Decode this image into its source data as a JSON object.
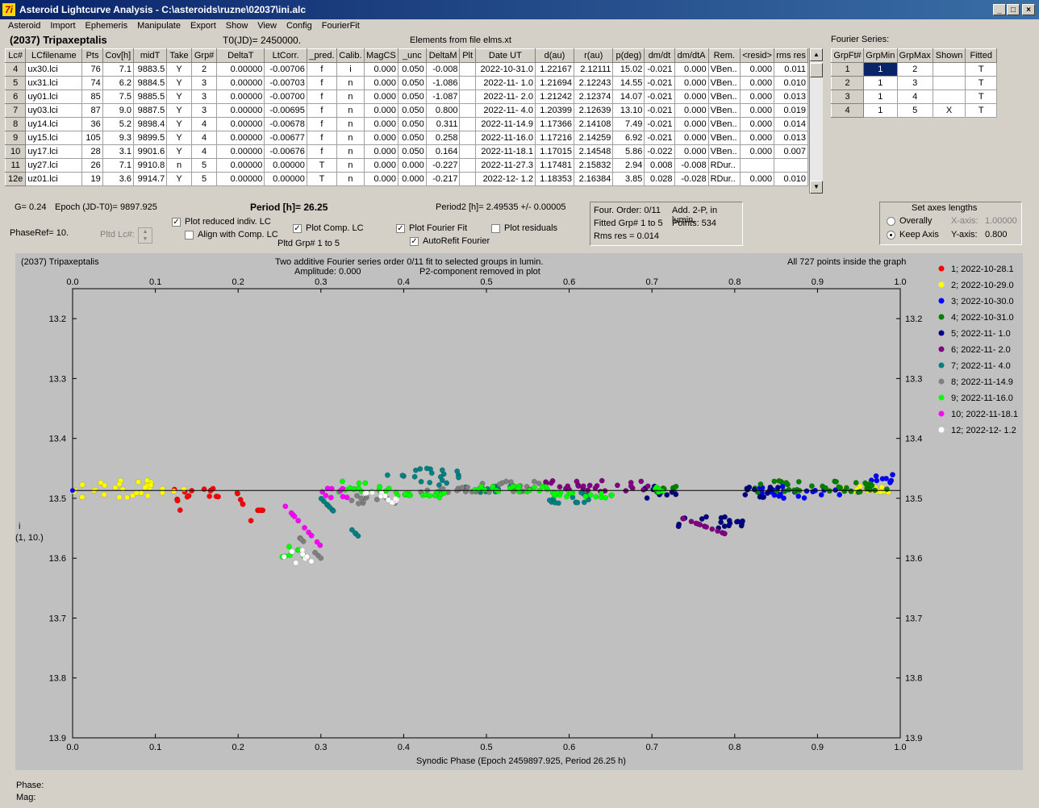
{
  "window": {
    "title": "Asteroid Lightcurve Analysis - C:\\asteroids\\ruzne\\02037\\ini.alc",
    "icon_label": "7i"
  },
  "menu": [
    "Asteroid",
    "Import",
    "Ephemeris",
    "Manipulate",
    "Export",
    "Show",
    "View",
    "Config",
    "FourierFit"
  ],
  "header": {
    "asteroid": "(2037) Tripaxeptalis",
    "t0": "T0(JD)= 2450000.",
    "elements": "Elements from file elms.xt",
    "fourier_label": "Fourier Series:"
  },
  "lc_table": {
    "columns": [
      "Lc#",
      "LCfilename",
      "Pts",
      "Cov[h]",
      "midT",
      "Take",
      "Grp#",
      "DeltaT",
      "LtCorr.",
      "_pred.",
      "Calib.",
      "MagCS",
      "_unc",
      "DeltaM",
      "Plt",
      "Date UT",
      "d(au)",
      "r(au)",
      "p(deg)",
      "dm/dt",
      "dm/dtA",
      "Rem.",
      "<resid>",
      "rms res"
    ],
    "rows": [
      [
        "4",
        "ux30.lci",
        "76",
        "7.1",
        "9883.5",
        "Y",
        "2",
        "0.00000",
        "-0.00706",
        "f",
        "i",
        "0.000",
        "0.050",
        "-0.008",
        "",
        "2022-10-31.0",
        "1.22167",
        "2.12111",
        "15.02",
        "-0.021",
        "0.000",
        "VBen..",
        "0.000",
        "0.011"
      ],
      [
        "5",
        "ux31.lci",
        "74",
        "6.2",
        "9884.5",
        "Y",
        "3",
        "0.00000",
        "-0.00703",
        "f",
        "n",
        "0.000",
        "0.050",
        "-1.086",
        "",
        "2022-11- 1.0",
        "1.21694",
        "2.12243",
        "14.55",
        "-0.021",
        "0.000",
        "VBen..",
        "0.000",
        "0.010"
      ],
      [
        "6",
        "uy01.lci",
        "85",
        "7.5",
        "9885.5",
        "Y",
        "3",
        "0.00000",
        "-0.00700",
        "f",
        "n",
        "0.000",
        "0.050",
        "-1.087",
        "",
        "2022-11- 2.0",
        "1.21242",
        "2.12374",
        "14.07",
        "-0.021",
        "0.000",
        "VBen..",
        "0.000",
        "0.013"
      ],
      [
        "7",
        "uy03.lci",
        "87",
        "9.0",
        "9887.5",
        "Y",
        "3",
        "0.00000",
        "-0.00695",
        "f",
        "n",
        "0.000",
        "0.050",
        "0.800",
        "",
        "2022-11- 4.0",
        "1.20399",
        "2.12639",
        "13.10",
        "-0.021",
        "0.000",
        "VBen..",
        "0.000",
        "0.019"
      ],
      [
        "8",
        "uy14.lci",
        "36",
        "5.2",
        "9898.4",
        "Y",
        "4",
        "0.00000",
        "-0.00678",
        "f",
        "n",
        "0.000",
        "0.050",
        "0.311",
        "",
        "2022-11-14.9",
        "1.17366",
        "2.14108",
        "7.49",
        "-0.021",
        "0.000",
        "VBen..",
        "0.000",
        "0.014"
      ],
      [
        "9",
        "uy15.lci",
        "105",
        "9.3",
        "9899.5",
        "Y",
        "4",
        "0.00000",
        "-0.00677",
        "f",
        "n",
        "0.000",
        "0.050",
        "0.258",
        "",
        "2022-11-16.0",
        "1.17216",
        "2.14259",
        "6.92",
        "-0.021",
        "0.000",
        "VBen..",
        "0.000",
        "0.013"
      ],
      [
        "10",
        "uy17.lci",
        "28",
        "3.1",
        "9901.6",
        "Y",
        "4",
        "0.00000",
        "-0.00676",
        "f",
        "n",
        "0.000",
        "0.050",
        "0.164",
        "",
        "2022-11-18.1",
        "1.17015",
        "2.14548",
        "5.86",
        "-0.022",
        "0.000",
        "VBen..",
        "0.000",
        "0.007"
      ],
      [
        "11",
        "uy27.lci",
        "26",
        "7.1",
        "9910.8",
        "n",
        "5",
        "0.00000",
        "0.00000",
        "T",
        "n",
        "0.000",
        "0.000",
        "-0.227",
        "",
        "2022-11-27.3",
        "1.17481",
        "2.15832",
        "2.94",
        "0.008",
        "-0.008",
        "RDur..",
        "",
        ""
      ],
      [
        "12e",
        "uz01.lci",
        "19",
        "3.6",
        "9914.7",
        "Y",
        "5",
        "0.00000",
        "0.00000",
        "T",
        "n",
        "0.000",
        "0.000",
        "-0.217",
        "",
        "2022-12- 1.2",
        "1.18353",
        "2.16384",
        "3.85",
        "0.028",
        "-0.028",
        "RDur..",
        "0.000",
        "0.010"
      ]
    ]
  },
  "fourier_table": {
    "columns": [
      "GrpFt#",
      "GrpMin",
      "GrpMax",
      "Shown",
      "Fitted"
    ],
    "rows": [
      [
        "1",
        "1",
        "2",
        "",
        "T"
      ],
      [
        "2",
        "1",
        "3",
        "",
        "T"
      ],
      [
        "3",
        "1",
        "4",
        "",
        "T"
      ],
      [
        "4",
        "1",
        "5",
        "X",
        "T"
      ]
    ]
  },
  "params": {
    "g": "G= 0.24",
    "epoch": "Epoch (JD-T0)= 9897.925",
    "period": "Period [h]= 26.25",
    "period2": "Period2 [h]= 2.49535 +/- 0.00005",
    "phase_ref": "PhaseRef= 10.",
    "pltd_lc": "Pltd Lc#:",
    "pltd_grp": "Pltd Grp#  1   to   5"
  },
  "checkboxes": {
    "plot_reduced": {
      "label": "Plot reduced indiv. LC",
      "checked": true
    },
    "align_comp": {
      "label": "Align with Comp. LC",
      "checked": false
    },
    "plot_comp": {
      "label": "Plot Comp. LC",
      "checked": true
    },
    "plot_fourier": {
      "label": "Plot Fourier Fit",
      "checked": true
    },
    "autorefit": {
      "label": "AutoRefit Fourier",
      "checked": true
    },
    "plot_resid": {
      "label": "Plot residuals",
      "checked": false
    }
  },
  "fourier_info": {
    "order": "Four. Order:  0/11",
    "add": "Add. 2-P, in lumin.",
    "fitted": "Fitted Grp# 1 to 5",
    "points": "Points: 534",
    "rms": "Rms res      = 0.014"
  },
  "axes_box": {
    "title": "Set axes lengths",
    "overally": "Overally",
    "keep": "Keep Axis",
    "xaxis_label": "X-axis:",
    "xaxis_val": "1.00000",
    "yaxis_label": "Y-axis:",
    "yaxis_val": "0.800"
  },
  "plot": {
    "name": "(2037) Tripaxeptalis",
    "desc1": "Two additive Fourier series order 0/11 fit to selected groups in lumin.",
    "desc2": "Amplitude: 0.000",
    "desc3": "P2-component removed in plot",
    "points_note": "All 727 points inside the graph",
    "ylabel1": "i",
    "ylabel2": "(1, 10.)",
    "xlabel": "Synodic Phase (Epoch 2459897.925, Period 26.25 h)"
  },
  "status": {
    "phase": "Phase:",
    "mag": "Mag:"
  },
  "chart_data": {
    "type": "scatter",
    "xlim": [
      0.0,
      1.0
    ],
    "ylim": [
      13.9,
      13.15
    ],
    "xticks": [
      "0.0",
      "0.1",
      "0.2",
      "0.3",
      "0.4",
      "0.5",
      "0.6",
      "0.7",
      "0.8",
      "0.9",
      "1.0"
    ],
    "yticks": [
      "13.2",
      "13.3",
      "13.4",
      "13.5",
      "13.6",
      "13.7",
      "13.8",
      "13.9"
    ],
    "fit_level": 13.487,
    "legend_position": "right",
    "series": [
      {
        "name": "1; 2022-10-28.1",
        "color": "#ff0000",
        "segments": [
          [
            0.12,
            0.13,
            13.47,
            13.52
          ],
          [
            0.13,
            0.18,
            13.48,
            13.5
          ],
          [
            0.195,
            0.22,
            13.48,
            13.55
          ],
          [
            0.22,
            0.23,
            13.52,
            13.52
          ]
        ]
      },
      {
        "name": "2; 2022-10-29.0",
        "color": "#ffff00",
        "segments": [
          [
            0.0,
            0.135,
            13.47,
            13.5
          ],
          [
            0.93,
            1.0,
            13.48,
            13.49
          ]
        ]
      },
      {
        "name": "3; 2022-10-30.0",
        "color": "#0000ff",
        "segments": [
          [
            0.82,
            0.93,
            13.48,
            13.5
          ],
          [
            0.96,
            1.0,
            13.46,
            13.48
          ]
        ]
      },
      {
        "name": "4; 2022-10-31.0",
        "color": "#008000",
        "segments": [
          [
            0.69,
            0.73,
            13.48,
            13.49
          ],
          [
            0.82,
            1.0,
            13.47,
            13.49
          ]
        ]
      },
      {
        "name": "5; 2022-11- 1.0",
        "color": "#000080",
        "segments": [
          [
            0.69,
            0.73,
            13.48,
            13.5
          ],
          [
            0.73,
            0.81,
            13.53,
            13.55
          ],
          [
            0.81,
            0.86,
            13.48,
            13.5
          ]
        ]
      },
      {
        "name": "6; 2022-11- 2.0",
        "color": "#800080",
        "segments": [
          [
            0.57,
            0.7,
            13.47,
            13.49
          ],
          [
            0.73,
            0.79,
            13.53,
            13.56
          ]
        ]
      },
      {
        "name": "7; 2022-11- 4.0",
        "color": "#008080",
        "segments": [
          [
            0.3,
            0.35,
            13.5,
            13.57
          ],
          [
            0.38,
            0.47,
            13.45,
            13.48
          ],
          [
            0.47,
            0.54,
            13.48,
            13.49
          ],
          [
            0.57,
            0.63,
            13.49,
            13.51
          ]
        ]
      },
      {
        "name": "8; 2022-11-14.9",
        "color": "#808080",
        "segments": [
          [
            0.27,
            0.3,
            13.56,
            13.6
          ],
          [
            0.33,
            0.39,
            13.49,
            13.51
          ],
          [
            0.42,
            0.49,
            13.48,
            13.49
          ],
          [
            0.49,
            0.57,
            13.47,
            13.49
          ]
        ]
      },
      {
        "name": "9; 2022-11-16.0",
        "color": "#00ff00",
        "segments": [
          [
            0.25,
            0.28,
            13.57,
            13.6
          ],
          [
            0.32,
            0.39,
            13.47,
            13.49
          ],
          [
            0.39,
            0.46,
            13.49,
            13.5
          ],
          [
            0.48,
            0.58,
            13.48,
            13.49
          ],
          [
            0.58,
            0.66,
            13.49,
            13.5
          ],
          [
            0.7,
            0.72,
            13.48,
            13.49
          ]
        ]
      },
      {
        "name": "10; 2022-11-18.1",
        "color": "#ff00ff",
        "segments": [
          [
            0.255,
            0.3,
            13.51,
            13.58
          ],
          [
            0.3,
            0.34,
            13.48,
            13.5
          ]
        ]
      },
      {
        "name": "12; 2022-12- 1.2",
        "color": "#ffffff",
        "segments": [
          [
            0.255,
            0.29,
            13.58,
            13.61
          ],
          [
            0.35,
            0.38,
            13.49,
            13.5
          ],
          [
            0.38,
            0.4,
            13.5,
            13.51
          ]
        ]
      }
    ]
  }
}
